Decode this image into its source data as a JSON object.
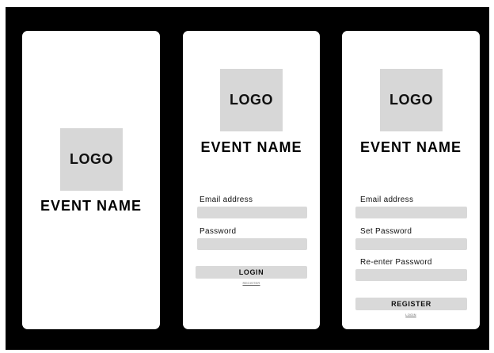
{
  "splash": {
    "logo": "LOGO",
    "event_name": "EVENT NAME"
  },
  "login": {
    "logo": "LOGO",
    "event_name": "EVENT NAME",
    "email_label": "Email address",
    "password_label": "Password",
    "login_button": "LOGIN",
    "register_link": "REGISTER"
  },
  "register": {
    "logo": "LOGO",
    "event_name": "EVENT NAME",
    "email_label": "Email address",
    "set_password_label": "Set Password",
    "reenter_password_label": "Re-enter Password",
    "register_button": "REGISTER",
    "login_link": "LOGIN"
  }
}
